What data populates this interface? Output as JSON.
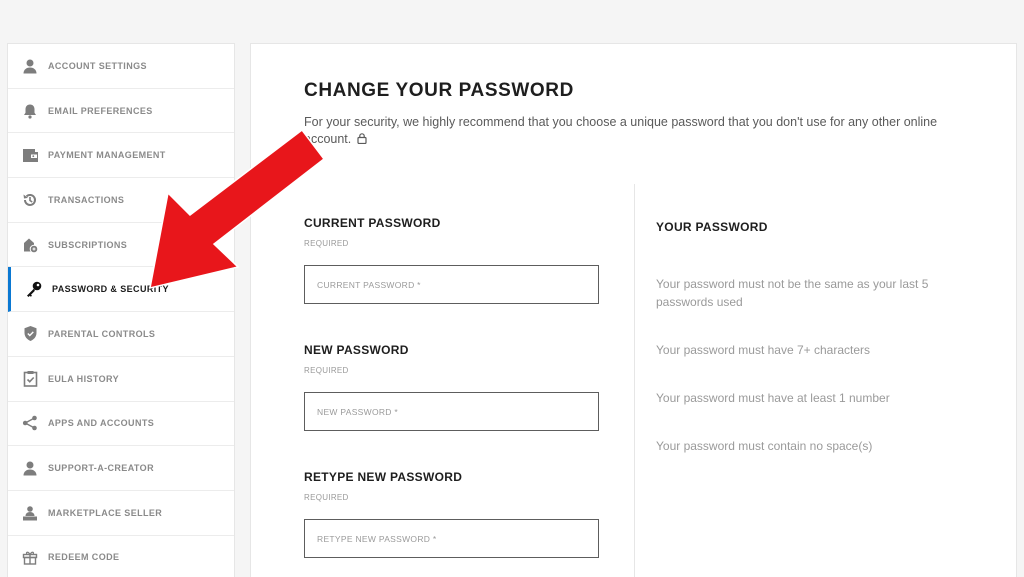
{
  "sidebar": {
    "items": [
      {
        "label": "Account Settings",
        "icon": "user-icon"
      },
      {
        "label": "Email Preferences",
        "icon": "bell-icon"
      },
      {
        "label": "Payment Management",
        "icon": "wallet-icon"
      },
      {
        "label": "Transactions",
        "icon": "history-icon"
      },
      {
        "label": "Subscriptions",
        "icon": "subscription-icon"
      },
      {
        "label": "Password & Security",
        "icon": "key-icon",
        "active": true
      },
      {
        "label": "Parental Controls",
        "icon": "shield-icon"
      },
      {
        "label": "EULA History",
        "icon": "clipboard-check-icon"
      },
      {
        "label": "Apps and Accounts",
        "icon": "share-icon"
      },
      {
        "label": "Support-A-Creator",
        "icon": "user-icon"
      },
      {
        "label": "Marketplace Seller",
        "icon": "seller-icon"
      },
      {
        "label": "Redeem Code",
        "icon": "gift-icon"
      }
    ]
  },
  "main": {
    "title": "CHANGE YOUR PASSWORD",
    "description": "For your security, we highly recommend that you choose a unique password that you don't use for any other online account.",
    "fields": {
      "current": {
        "label": "CURRENT PASSWORD",
        "required": "REQUIRED",
        "placeholder": "CURRENT PASSWORD *",
        "value": ""
      },
      "new": {
        "label": "NEW PASSWORD",
        "required": "REQUIRED",
        "placeholder": "NEW PASSWORD *",
        "value": ""
      },
      "retype": {
        "label": "RETYPE NEW PASSWORD",
        "required": "REQUIRED",
        "placeholder": "RETYPE NEW PASSWORD *",
        "value": ""
      }
    },
    "rules": {
      "title": "YOUR PASSWORD",
      "items": [
        "Your password must not be the same as your last 5 passwords used",
        "Your password must have 7+ characters",
        "Your password must have at least 1 number",
        "Your password must contain no space(s)"
      ]
    }
  },
  "colors": {
    "accent": "#0a78d2",
    "annotation_arrow": "#e8161b"
  }
}
